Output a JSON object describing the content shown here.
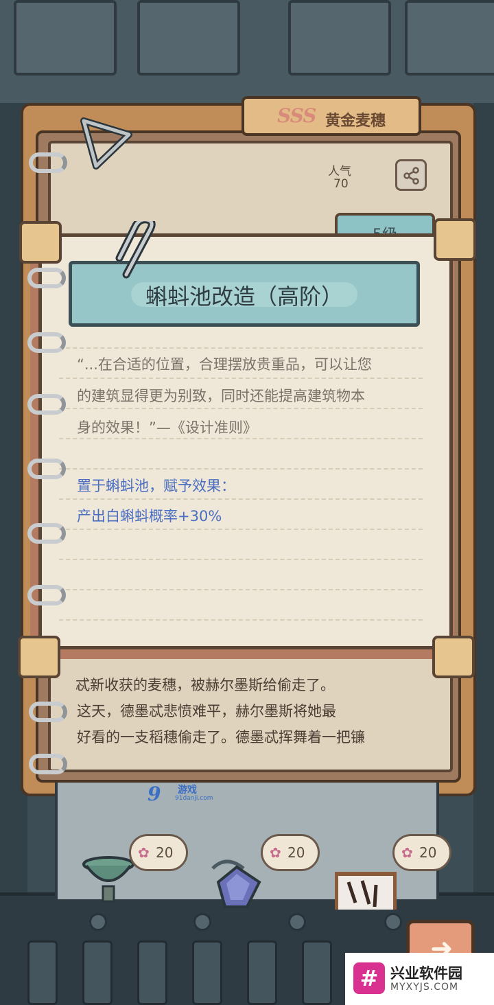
{
  "book": {
    "rarity": "SSS",
    "item_name": "黄金麦穗",
    "stat_label": "人气",
    "stat_value": "70",
    "story_line_1": "忒新收获的麦穗，被赫尔墨斯给偷走了。",
    "story_line_2": "这天，德墨忒悲愤难平，赫尔墨斯将她最",
    "story_line_3": "好看的一支稻穗偷走了。德墨忒挥舞着一把镰",
    "share_icon": "share-icon"
  },
  "dialog": {
    "level": "5级",
    "title": "蝌蚪池改造（高阶）",
    "quote_lines": [
      "“...在合适的位置，合理摆放贵重品，可以让您",
      "的建筑显得更为别致，同时还能提高建筑物本",
      "身的效果！”—《设计准则》"
    ],
    "effect_heading": "置于蝌蚪池，赋予效果：",
    "effect_line": "产出白蝌蚪概率+30%"
  },
  "decorations": [
    {
      "cost": "20",
      "icon": "flower-icon"
    },
    {
      "cost": "20",
      "icon": "flower-icon"
    },
    {
      "cost": "20",
      "icon": "flower-icon"
    }
  ],
  "next_button": {
    "icon": "arrow-right-icon",
    "glyph": "➜"
  },
  "watermark_91": {
    "mark": "9",
    "name": "游戏",
    "url": "91danji.com"
  },
  "site_watermark": {
    "logo": "#",
    "name": "兴业软件园",
    "url": "MYXYJS.COM"
  },
  "colors": {
    "accent_teal": "#96c6c8",
    "effect_blue": "#4a6ec2",
    "paper": "#efe7d7",
    "gold": "#e7c58e"
  }
}
